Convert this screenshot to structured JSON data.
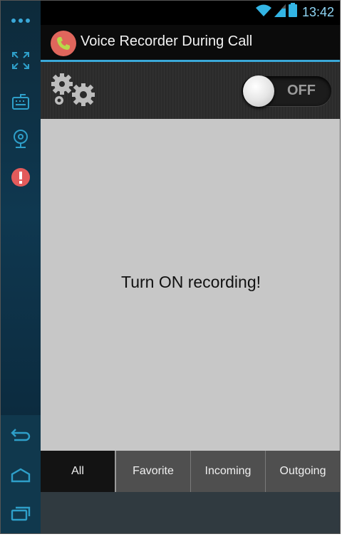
{
  "status_bar": {
    "time": "13:42",
    "icons": [
      "wifi-icon",
      "signal-icon",
      "battery-icon"
    ]
  },
  "app": {
    "title": "Voice Recorder During Call",
    "icon": "phone-handset-icon",
    "accent_color": "#3aa8d8"
  },
  "toolbar": {
    "settings_icon": "gears-icon",
    "recording_switch": {
      "state_label": "OFF",
      "on": false
    }
  },
  "main": {
    "empty_message": "Turn ON recording!"
  },
  "tabs": [
    {
      "label": "All",
      "selected": true
    },
    {
      "label": "Favorite",
      "selected": false
    },
    {
      "label": "Incoming",
      "selected": false
    },
    {
      "label": "Outgoing",
      "selected": false
    }
  ],
  "sidebar": {
    "icons": [
      "more-dots-icon",
      "fullscreen-icon",
      "keyboard-icon",
      "camera-icon",
      "alert-icon",
      "back-icon",
      "home-icon",
      "recents-icon"
    ]
  }
}
